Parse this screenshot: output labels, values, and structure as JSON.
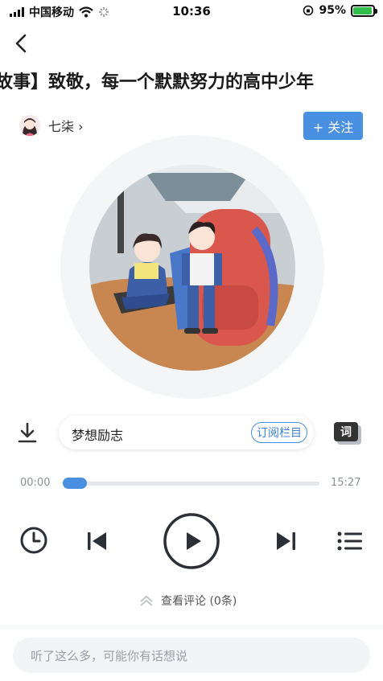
{
  "status_bar": {
    "carrier": "中国移动",
    "time": "10:36",
    "battery": "95%",
    "battery_level": 0.95
  },
  "header": {
    "title": "故事】致敬，每一个默默努力的高中少年"
  },
  "author": {
    "name": "七柒 ›",
    "follow_label": "+ 关注"
  },
  "column": {
    "name": "梦想励志",
    "subscribe_label": "订阅栏目"
  },
  "lyrics_label": "词",
  "player": {
    "current_time": "00:00",
    "total_time": "15:27",
    "progress": 0.0
  },
  "comments": {
    "view_label": "查看评论 (0条)",
    "input_placeholder": "听了这么多，可能你有话想说"
  },
  "colors": {
    "accent": "#4a90e2",
    "battery_fill": "#2fbf4a"
  },
  "icons": [
    "signal-icon",
    "wifi-icon",
    "orientation-lock-icon",
    "battery-icon",
    "back-arrow-icon",
    "download-icon",
    "lyrics-icon",
    "timer-icon",
    "previous-icon",
    "play-icon",
    "next-icon",
    "playlist-icon",
    "chevron-up-icon"
  ]
}
